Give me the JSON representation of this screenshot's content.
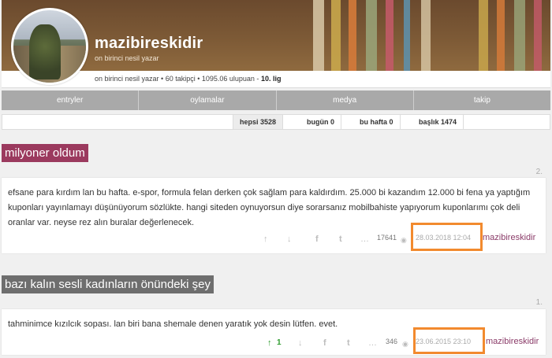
{
  "profile": {
    "username": "mazibireskidir",
    "subtitle": "on birinci nesil yazar",
    "meta_prefix": "on birinci nesil yazar • 60 takipçi • 1095.06 ulupuan - ",
    "meta_rank": "10. lig"
  },
  "tabs": [
    "entryler",
    "oylamalar",
    "medya",
    "takip"
  ],
  "filters": [
    "hepsi 3528",
    "bugün 0",
    "bu hafta 0",
    "başlık 1474"
  ],
  "entries": [
    {
      "topic": "milyoner oldum",
      "topic_color": "#9b3a5e",
      "index": "2.",
      "content": "efsane para kırdım lan bu hafta. e-spor, formula felan derken çok sağlam para kaldırdım. 25.000 bi kazandım 12.000 bi fena ya yaptığım kuponları yayınlamayı düşünüyorum sözlükte. hangi siteden oynuyorsun diye sorarsanız mobilbahiste yapıyorum kuponlarımı çok deli oranlar var. neyse rez alın buralar değerlenecek.",
      "upvotes": "",
      "views": "17641",
      "date": "28.03.2018 12:04",
      "author": "mazibireskidir"
    },
    {
      "topic": "bazı kalın sesli kadınların önündeki şey",
      "topic_color": "#6e6e6e",
      "index": "1.",
      "content": "tahminimce kızılcık sopası. lan biri bana shemale denen yaratık yok desin lütfen. evet.",
      "upvotes": "1",
      "views": "346",
      "date": "23.06.2015 23:10",
      "author": "mazibireskidir"
    }
  ],
  "icons": {
    "up": "↑",
    "down": "↓",
    "facebook": "f",
    "twitter": "t",
    "more": "…",
    "eye": "◉"
  },
  "highlight_color": "#f28a2e"
}
